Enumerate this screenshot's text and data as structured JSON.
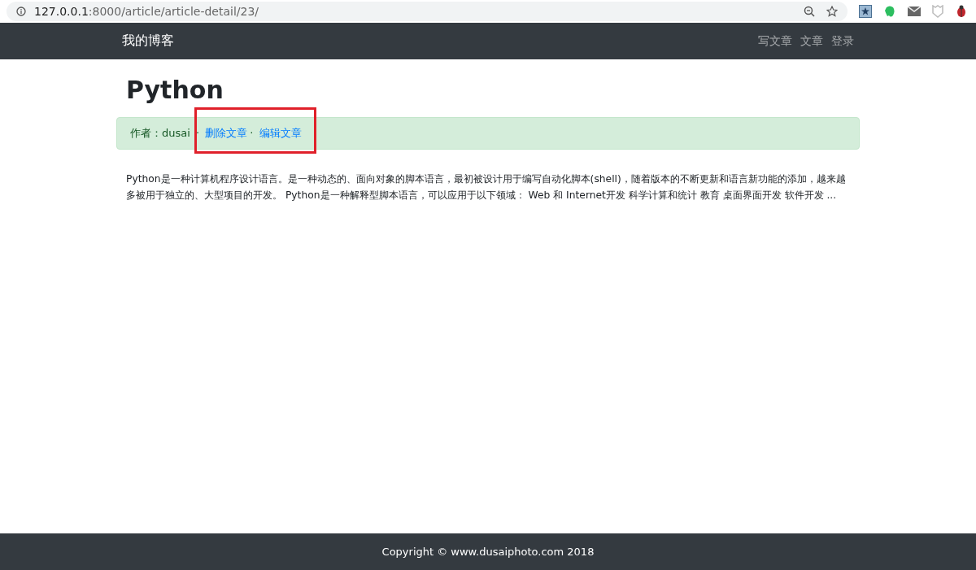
{
  "browser": {
    "url_host": "127.0.0.1",
    "url_path": ":8000/article/article-detail/23/"
  },
  "navbar": {
    "brand": "我的博客",
    "links": [
      "写文章",
      "文章",
      "登录"
    ]
  },
  "article": {
    "title": "Python",
    "meta": {
      "author_label": "作者：",
      "author": "dusai",
      "separator": "·",
      "actions": [
        "删除文章",
        "编辑文章"
      ],
      "highlighted": true
    },
    "body": "Python是一种计算机程序设计语言。是一种动态的、面向对象的脚本语言，最初被设计用于编写自动化脚本(shell)，随着版本的不断更新和语言新功能的添加，越来越多被用于独立的、大型项目的开发。 Python是一种解释型脚本语言，可以应用于以下领域： Web 和 Internet开发 科学计算和统计 教育 桌面界面开发 软件开发 ..."
  },
  "footer": {
    "copyright": "Copyright © www.dusaiphoto.com 2018"
  }
}
